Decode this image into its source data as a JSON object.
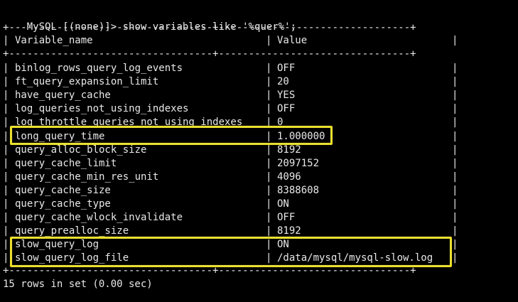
{
  "terminal": {
    "prompt": "MySQL [(none)]>",
    "command": "show variables like '%quer%';",
    "border_line": "+----------------------------------+--------------------------------+",
    "pipe": "|",
    "header": {
      "name": "Variable_name",
      "value": "Value"
    },
    "rows": [
      {
        "name": "binlog_rows_query_log_events",
        "value": "OFF"
      },
      {
        "name": "ft_query_expansion_limit",
        "value": "20"
      },
      {
        "name": "have_query_cache",
        "value": "YES"
      },
      {
        "name": "log_queries_not_using_indexes",
        "value": "OFF"
      },
      {
        "name": "log_throttle_queries_not_using_indexes",
        "value": "0"
      },
      {
        "name": "long_query_time",
        "value": "1.000000"
      },
      {
        "name": "query_alloc_block_size",
        "value": "8192"
      },
      {
        "name": "query_cache_limit",
        "value": "2097152"
      },
      {
        "name": "query_cache_min_res_unit",
        "value": "4096"
      },
      {
        "name": "query_cache_size",
        "value": "8388608"
      },
      {
        "name": "query_cache_type",
        "value": "ON"
      },
      {
        "name": "query_cache_wlock_invalidate",
        "value": "OFF"
      },
      {
        "name": "query_prealloc_size",
        "value": "8192"
      },
      {
        "name": "slow_query_log",
        "value": "ON"
      },
      {
        "name": "slow_query_log_file",
        "value": "/data/mysql/mysql-slow.log"
      }
    ],
    "footer": "15 rows in set (0.00 sec)"
  },
  "colors": {
    "background": "#000000",
    "text": "#e8e8e8",
    "highlight_box": "#f2e600"
  }
}
